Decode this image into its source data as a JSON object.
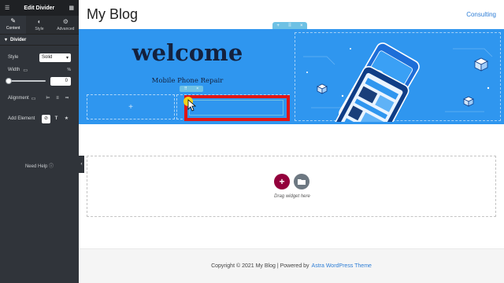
{
  "editor": {
    "title": "Edit Divider",
    "tabs": [
      {
        "label": "Content",
        "icon": "pencil-icon"
      },
      {
        "label": "Style",
        "icon": "half-circle-icon"
      },
      {
        "label": "Advanced",
        "icon": "gear-icon"
      }
    ],
    "section_title": "Divider",
    "style_label": "Style",
    "style_value": "Solid",
    "width_label": "Width",
    "width_unit": "%",
    "width_value": "0",
    "alignment_label": "Alignment",
    "add_element_label": "Add Element",
    "need_help": "Need Help"
  },
  "site": {
    "title": "My Blog",
    "nav": [
      "Consulting"
    ]
  },
  "hero": {
    "heading": "welcome",
    "subheading": "Mobile Phone Repair",
    "bg_color": "#2f96ef"
  },
  "dropzone": {
    "text": "Drag widget here"
  },
  "footer": {
    "copyright": "Copyright © 2021 My Blog | Powered by",
    "theme_link": "Astra WordPress Theme"
  },
  "colors": {
    "editor_bg": "#30343a",
    "accent": "#6ec1e4",
    "highlight": "#e01616",
    "add_button": "#93003c"
  }
}
